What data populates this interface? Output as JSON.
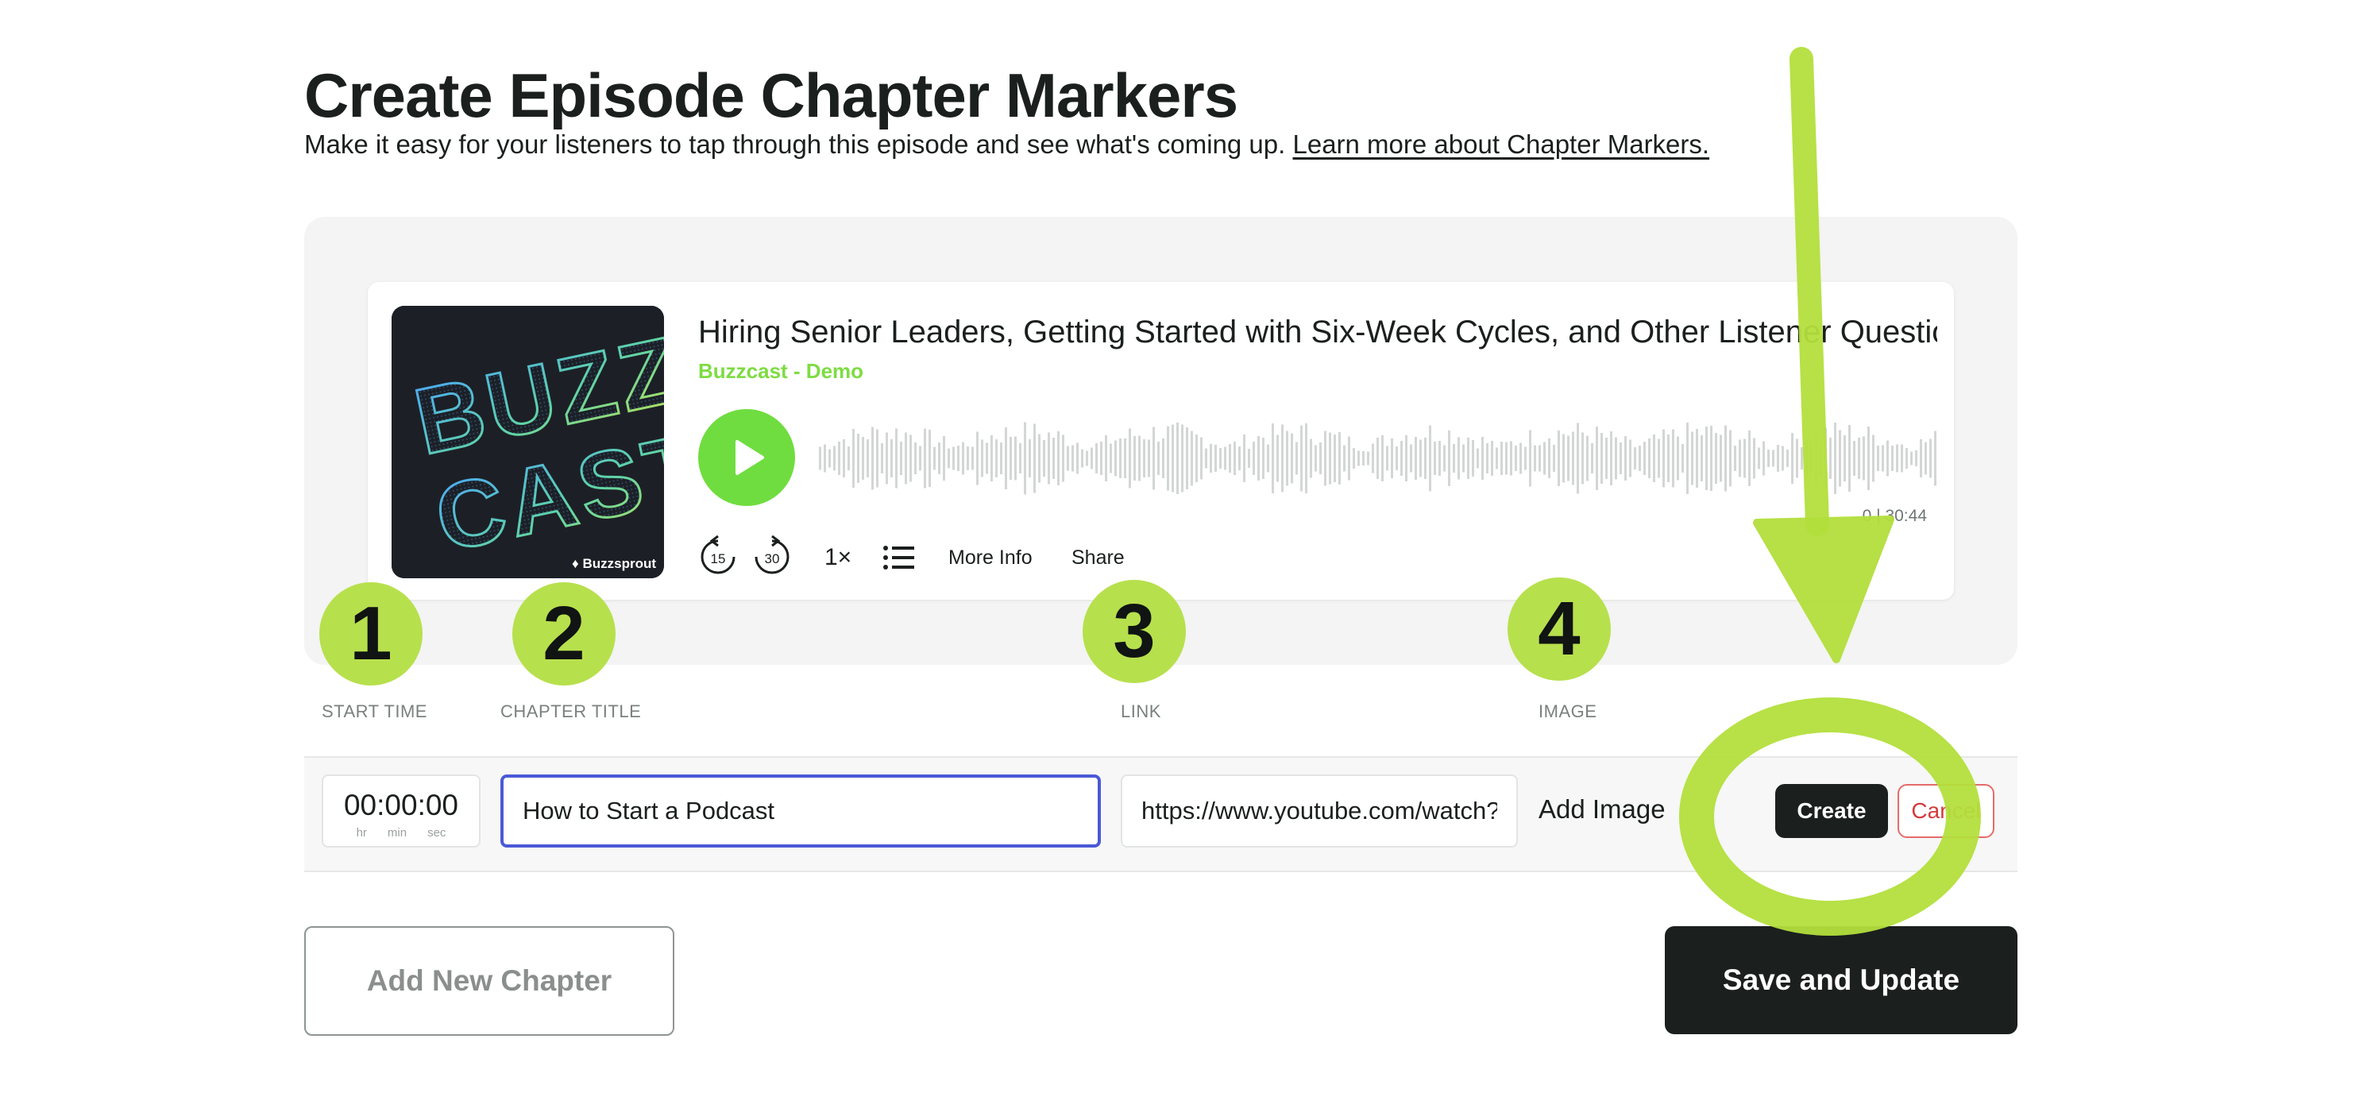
{
  "header": {
    "title": "Create Episode Chapter Markers",
    "subtitle": "Make it easy for your listeners to tap through this episode and see what's coming up.",
    "learn_more_link": "Learn more about Chapter Markers."
  },
  "player": {
    "episode_title": "Hiring Senior Leaders, Getting Started with Six-Week Cycles, and Other Listener Questio",
    "show_name": "Buzzcast - Demo",
    "artwork_text": [
      "BUZZ",
      "CAST"
    ],
    "artwork_brand": "Buzzsprout",
    "time_readout": "0 | 30:44",
    "skip_back": "15",
    "skip_forward": "30",
    "speed": "1×",
    "more_info": "More Info",
    "share": "Share",
    "play_icon": "play-icon",
    "chapters_icon": "list-icon"
  },
  "steps": [
    "1",
    "2",
    "3",
    "4"
  ],
  "columns": {
    "start_time": "START TIME",
    "chapter_title": "CHAPTER TITLE",
    "link": "LINK",
    "image": "IMAGE"
  },
  "chapter_row": {
    "start_time": "00:00:00",
    "time_units": [
      "hr",
      "min",
      "sec"
    ],
    "title_value": "How to Start a Podcast",
    "link_value": "https://www.youtube.com/watch?",
    "add_image": "Add Image",
    "create": "Create",
    "cancel": "Cancel"
  },
  "buttons": {
    "add_new_chapter": "Add New Chapter",
    "save_and_update": "Save and Update"
  },
  "colors": {
    "accent_green": "#b7e04d",
    "play_green": "#6fdd3f",
    "dark": "#1b1f1e",
    "focus_blue": "#4a59d6",
    "cancel_red": "#d43b3b"
  }
}
